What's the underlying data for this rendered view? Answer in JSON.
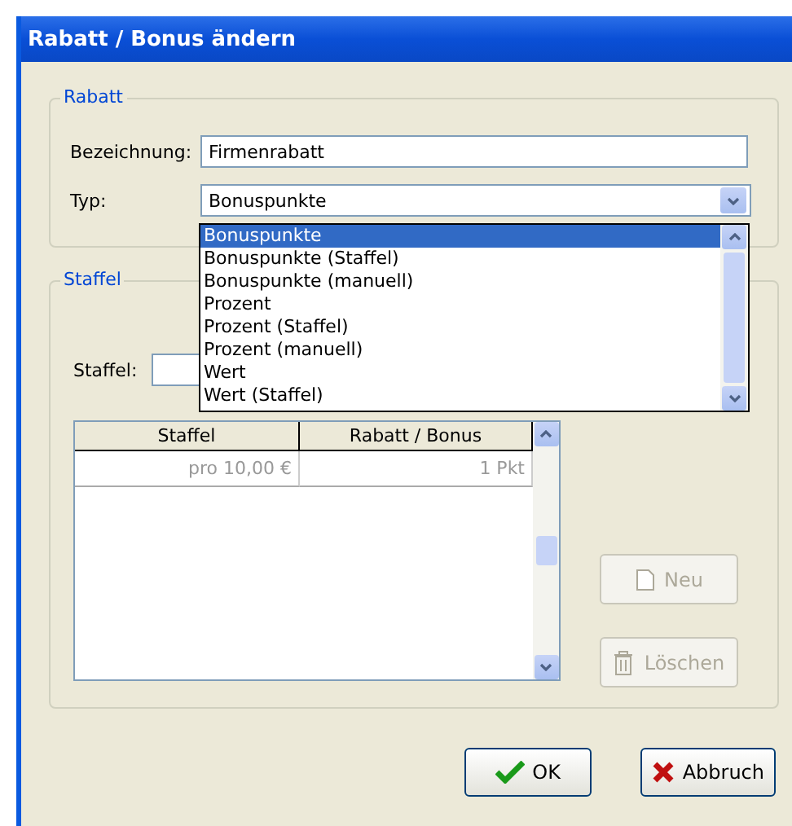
{
  "window": {
    "title": "Rabatt / Bonus ändern"
  },
  "rabatt": {
    "legend": "Rabatt",
    "name_label": "Bezeichnung:",
    "name_value": "Firmenrabatt",
    "type_label": "Typ:",
    "type_value": "Bonuspunkte",
    "type_options": [
      {
        "label": "Bonuspunkte",
        "selected": true
      },
      {
        "label": "Bonuspunkte (Staffel)",
        "selected": false
      },
      {
        "label": "Bonuspunkte (manuell)",
        "selected": false
      },
      {
        "label": "Prozent",
        "selected": false
      },
      {
        "label": "Prozent (Staffel)",
        "selected": false
      },
      {
        "label": "Prozent (manuell)",
        "selected": false
      },
      {
        "label": "Wert",
        "selected": false
      },
      {
        "label": "Wert (Staffel)",
        "selected": false
      }
    ]
  },
  "staffel": {
    "legend": "Staffel",
    "field_label": "Staffel:",
    "table": {
      "columns": [
        "Staffel",
        "Rabatt / Bonus"
      ],
      "rows": [
        [
          "pro 10,00 €",
          "1 Pkt"
        ]
      ]
    },
    "buttons": [
      {
        "kind": "new",
        "label": "Neu",
        "disabled": true
      },
      {
        "kind": "delete",
        "label": "Löschen",
        "disabled": true
      }
    ]
  },
  "footer_buttons": [
    {
      "kind": "ok",
      "label": "OK"
    },
    {
      "kind": "cancel",
      "label": "Abbruch"
    }
  ]
}
